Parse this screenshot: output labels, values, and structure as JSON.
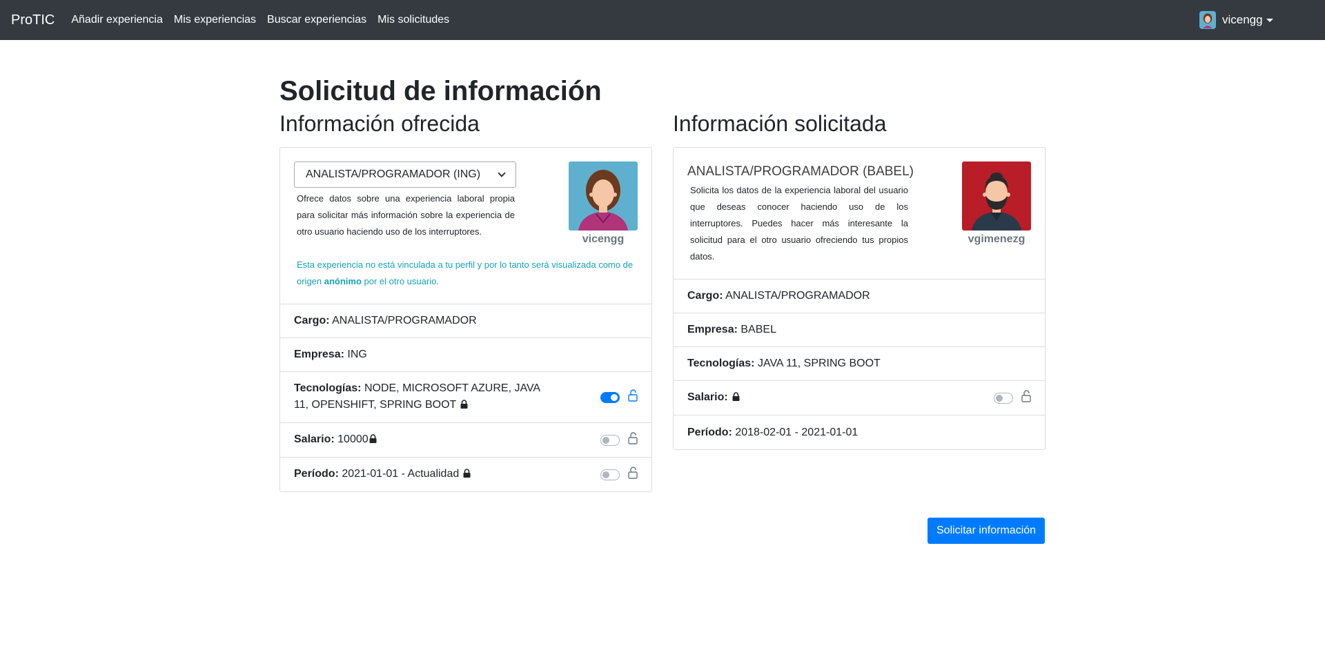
{
  "navbar": {
    "brand": "ProTIC",
    "links": [
      "Añadir experiencia",
      "Mis experiencias",
      "Buscar experiencias",
      "Mis solicitudes"
    ],
    "user": "vicengg",
    "bg_color": "#343a40"
  },
  "page": {
    "title": "Solicitud de información"
  },
  "offered": {
    "heading": "Información ofrecida",
    "select_value": "ANALISTA/PROGRAMADOR (ING)",
    "description": "Ofrece datos sobre una experiencia laboral propia para solicitar más información sobre la experiencia de otro usuario haciendo uso de los interruptores.",
    "note_prefix": "Esta experiencia no está vinculada a tu perfil y por lo tanto será visualizada como de origen ",
    "note_bold": "anónimo",
    "note_suffix": " por el otro usuario.",
    "avatar_name": "vicengg",
    "avatar_bg": "#5fb0cf",
    "fields": [
      {
        "label": "Cargo:",
        "value": "ANALISTA/PROGRAMADOR"
      },
      {
        "label": "Empresa:",
        "value": "ING"
      },
      {
        "label": "Tecnologías:",
        "value": "NODE, MICROSOFT AZURE, JAVA 11, OPENSHIFT, SPRING BOOT",
        "switch_on": true
      },
      {
        "label": "Salario:",
        "value": "10000",
        "switch_on": false
      },
      {
        "label": "Período:",
        "value": "2021-01-01 - Actualidad",
        "switch_on": false
      }
    ]
  },
  "requested": {
    "heading": "Información solicitada",
    "title": "ANALISTA/PROGRAMADOR (BABEL)",
    "description": "Solicita los datos de la experiencia laboral del usuario que deseas conocer haciendo uso de los interruptores. Puedes hacer más interesante la solicitud para el otro usuario ofreciendo tus propios datos.",
    "avatar_name": "vgimenezg",
    "avatar_bg": "#b81d28",
    "fields": [
      {
        "label": "Cargo:",
        "value": "ANALISTA/PROGRAMADOR"
      },
      {
        "label": "Empresa:",
        "value": "BABEL"
      },
      {
        "label": "Tecnologías:",
        "value": "JAVA 11, SPRING BOOT"
      },
      {
        "label": "Salario:",
        "value": "",
        "switch_on": false
      },
      {
        "label": "Período:",
        "value": "2018-02-01 - 2021-01-01"
      }
    ]
  },
  "actions": {
    "submit_label": "Solicitar información",
    "accent": "#007bff",
    "note_color": "#17a2b8"
  }
}
